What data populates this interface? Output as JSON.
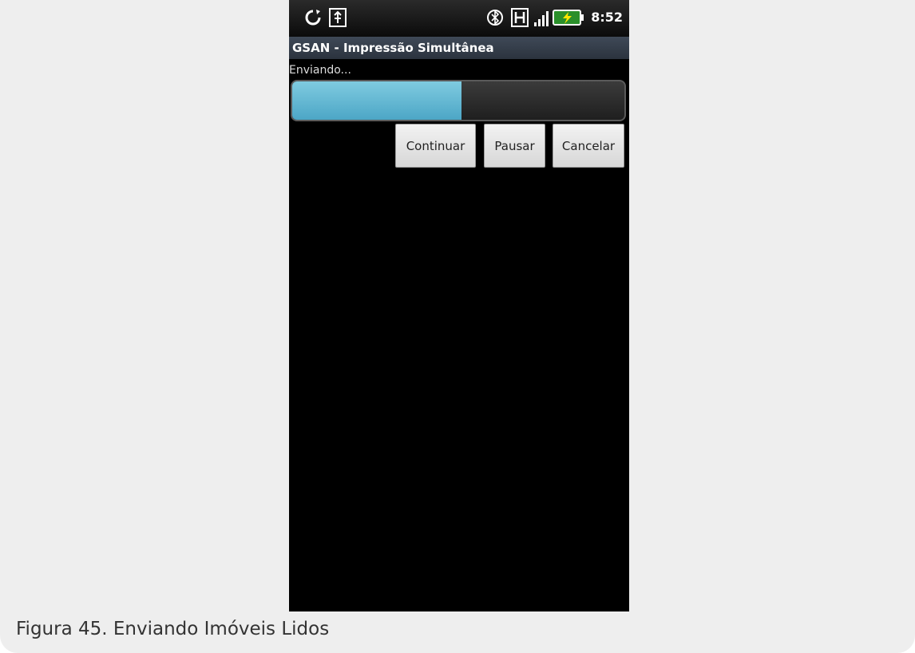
{
  "status_bar": {
    "time": "8:52",
    "icons": [
      "sync-icon",
      "usb-icon",
      "bluetooth-icon",
      "vibrate-icon",
      "signal-icon",
      "battery-charging-icon"
    ]
  },
  "app": {
    "title": "GSAN - Impressão Simultânea"
  },
  "progress": {
    "label": "Enviando...",
    "fraction": 0.51,
    "fill_color": "#6fbfd8"
  },
  "buttons": {
    "continuar": "Continuar",
    "pausar": "Pausar",
    "cancelar": "Cancelar"
  },
  "caption": "Figura 45. Enviando Imóveis Lidos"
}
